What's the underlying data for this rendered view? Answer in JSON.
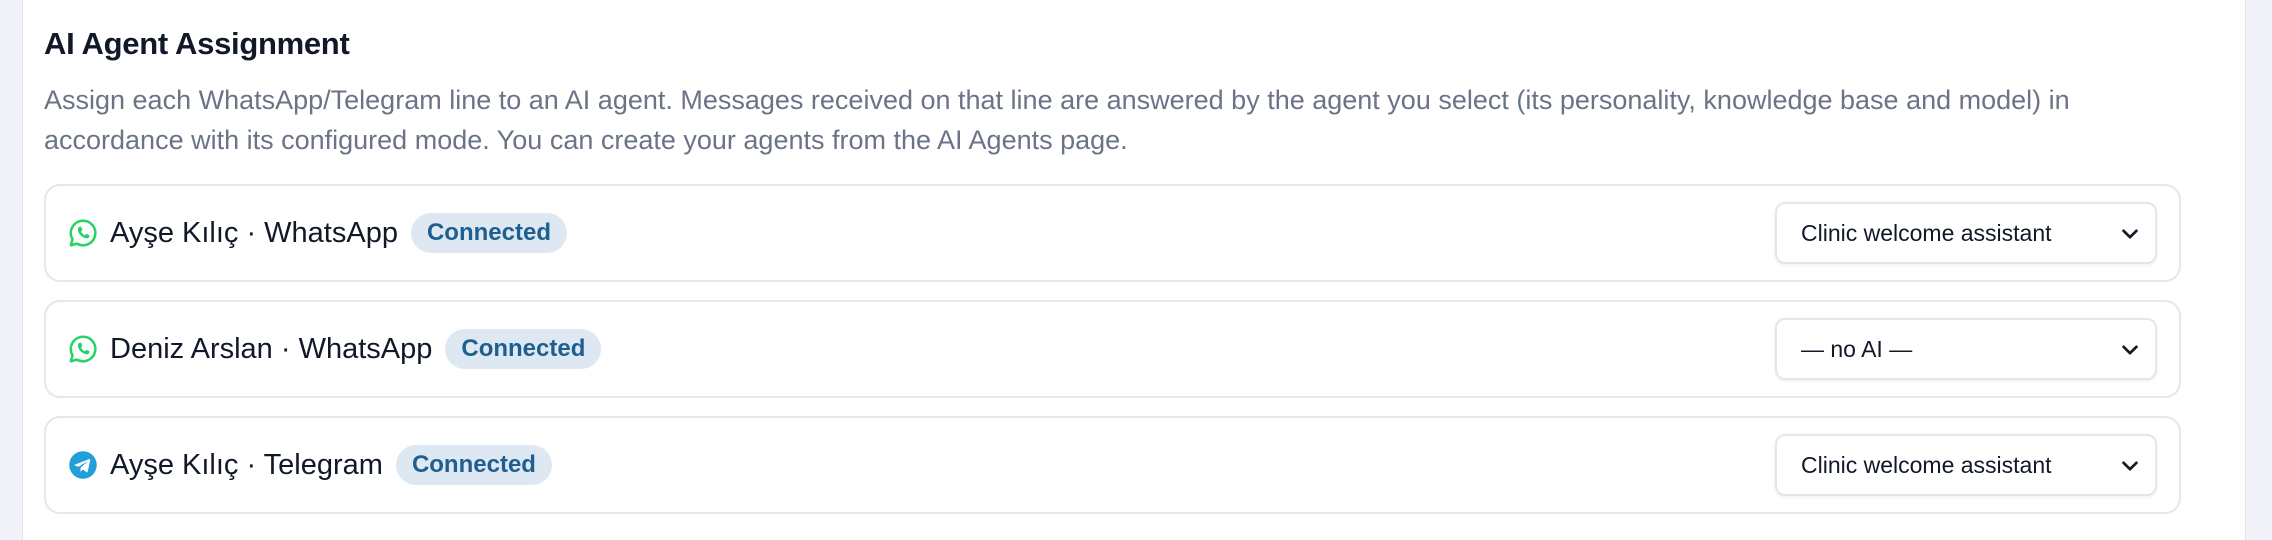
{
  "section": {
    "title": "AI Agent Assignment",
    "description": "Assign each WhatsApp/Telegram line to an AI agent. Messages received on that line are answered by the agent you select (its personality, knowledge base and model) in accordance with its configured mode. You can create your agents from the AI Agents page."
  },
  "lines": [
    {
      "icon": "whatsapp-icon",
      "icon_color": "#25D366",
      "label": "Ayşe Kılıç · WhatsApp",
      "status": "Connected",
      "agent": "Clinic welcome assistant"
    },
    {
      "icon": "whatsapp-icon",
      "icon_color": "#25D366",
      "label": "Deniz Arslan · WhatsApp",
      "status": "Connected",
      "agent": "— no AI —"
    },
    {
      "icon": "telegram-icon",
      "icon_color": "#229ED9",
      "label": "Ayşe Kılıç · Telegram",
      "status": "Connected",
      "agent": "Clinic welcome assistant"
    }
  ],
  "colors": {
    "badge_bg": "#dde8f3",
    "badge_text": "#1f5f8f",
    "description_text": "#6b7487"
  }
}
